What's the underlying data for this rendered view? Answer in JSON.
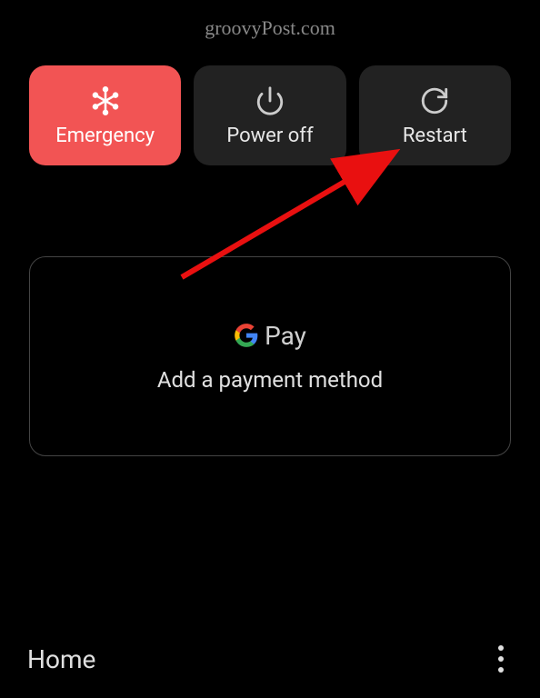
{
  "watermark": "groovyPost.com",
  "buttons": {
    "emergency": "Emergency",
    "poweroff": "Power off",
    "restart": "Restart"
  },
  "pay": {
    "brand": "Pay",
    "subtitle": "Add a payment method"
  },
  "bottom": {
    "home": "Home"
  }
}
